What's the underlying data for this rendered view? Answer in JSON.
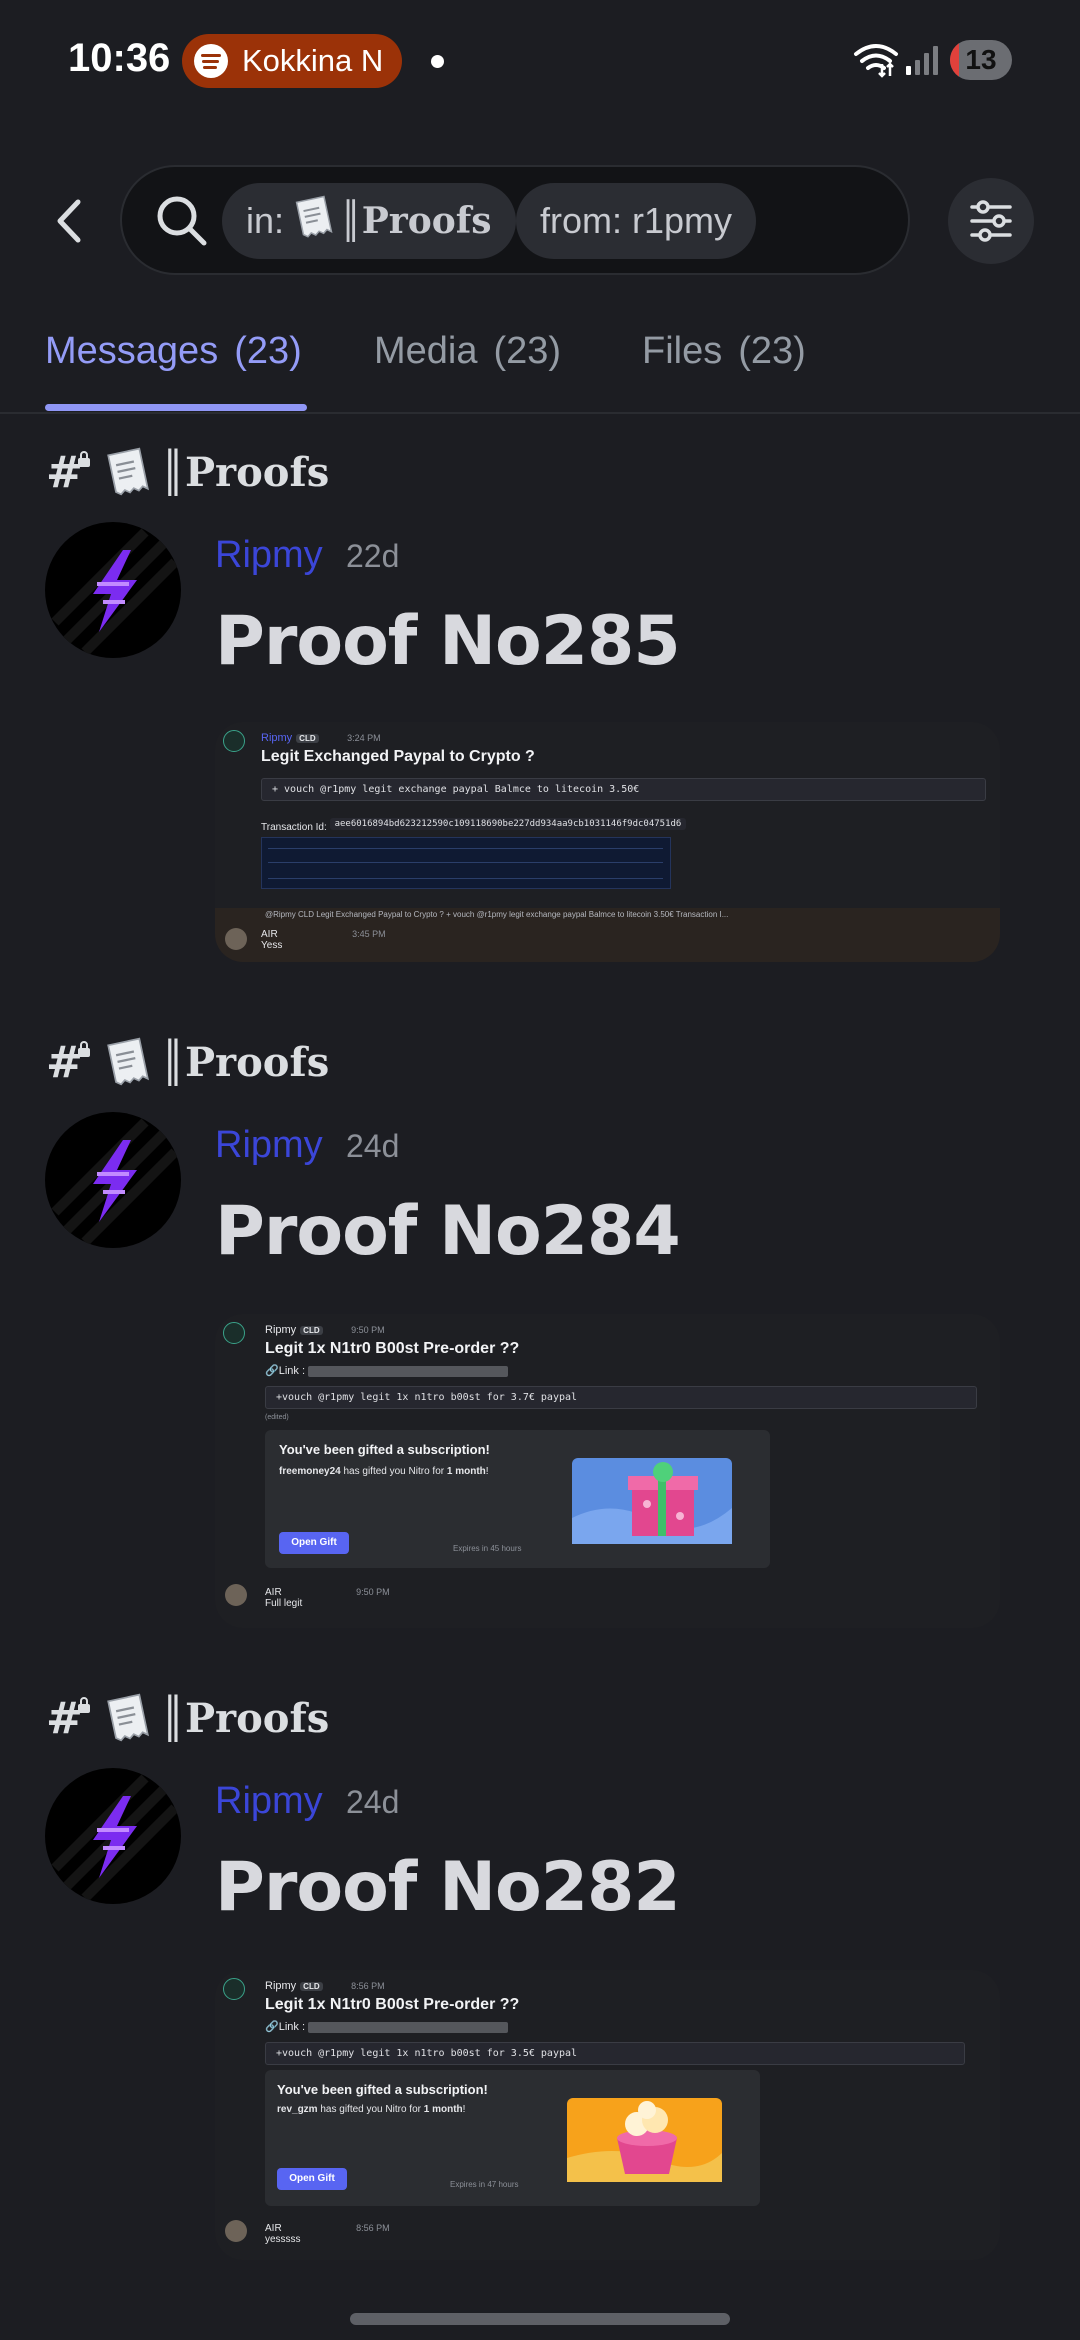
{
  "status_bar": {
    "time": "10:36",
    "now_playing": "Kokkina N",
    "battery_level": "13"
  },
  "search": {
    "chip_in_prefix": "in:",
    "chip_in_channel": "Proofs",
    "chip_from": "from: r1pmy"
  },
  "tabs": [
    {
      "label": "Messages",
      "count": "(23)"
    },
    {
      "label": "Media",
      "count": "(23)"
    },
    {
      "label": "Files",
      "count": "(23)"
    }
  ],
  "results": [
    {
      "channel": "Proofs",
      "author": "Ripmy",
      "age": "22d",
      "title": "Proof No285",
      "shot": {
        "author": "Ripmy",
        "role": "CLD",
        "time": "3:24 PM",
        "heading": "Legit Exchanged Paypal to Crypto  ?",
        "code": "+ vouch @r1pmy legit exchange paypal Balmce to litecoin 3.50€",
        "tx_label": "Transaction Id:",
        "tx_id": "aee6016894bd623212590c109118690be227dd934aa9cb1031146f9dc04751d6",
        "reply_preview": "@Ripmy  CLD  Legit Exchanged Paypal to Crypto ?  + vouch @r1pmy legit exchange paypal Balmce to litecoin 3.50€  Transaction I...",
        "reply_author": "AIR",
        "reply_time": "3:45 PM",
        "reply_text": "Yess"
      }
    },
    {
      "channel": "Proofs",
      "author": "Ripmy",
      "age": "24d",
      "title": "Proof No284",
      "shot": {
        "author": "Ripmy",
        "role": "CLD",
        "time": "9:50 PM",
        "heading": "Legit 1x N1tr0 B00st Pre-order ??",
        "link_label": "Link :",
        "code": "+vouch @r1pmy legit 1x n1tro b00st for 3.7€ paypal",
        "edited": "(edited)",
        "gift_heading": "You've been gifted a subscription!",
        "gift_from": "freemoney24",
        "gift_text": " has gifted you Nitro for ",
        "gift_duration": "1 month",
        "gift_end": "!",
        "button": "Open Gift",
        "expires": "Expires in 45 hours",
        "reply_author": "AIR",
        "reply_time": "9:50 PM",
        "reply_text": "Full legit"
      }
    },
    {
      "channel": "Proofs",
      "author": "Ripmy",
      "age": "24d",
      "title": "Proof No282",
      "shot": {
        "author": "Ripmy",
        "role": "CLD",
        "time": "8:56 PM",
        "heading": "Legit 1x N1tr0 B00st Pre-order ??",
        "link_label": "Link :",
        "code": "+vouch @r1pmy legit 1x n1tro b00st for 3.5€ paypal",
        "gift_heading": "You've been gifted a subscription!",
        "gift_from": "rev_gzm",
        "gift_text": " has gifted you Nitro for ",
        "gift_duration": "1 month",
        "gift_end": "!",
        "button": "Open Gift",
        "expires": "Expires in 47 hours",
        "reply_author": "AIR",
        "reply_time": "8:56 PM",
        "reply_text": "yesssss"
      }
    }
  ],
  "colors": {
    "background": "#1c1d22",
    "accent_tab": "#949cf7",
    "author_name": "#3b46d8",
    "spotify_pill": "#9b3208",
    "gift_button": "#5865f2"
  }
}
